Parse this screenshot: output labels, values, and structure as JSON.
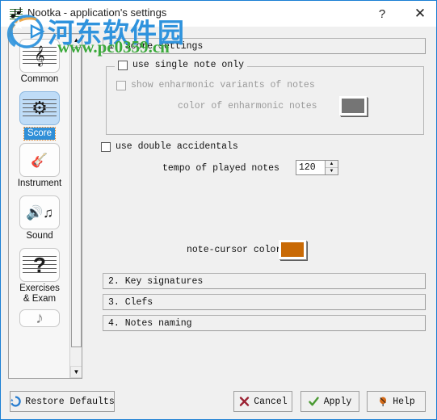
{
  "window": {
    "title": "Nootka - application's settings",
    "app_icon": "nootka-icon",
    "help_button": "?",
    "close_button": "✕",
    "border_color": "#1a7fd4"
  },
  "sidebar": {
    "scrollbar": {
      "up_arrow": "▲",
      "down_arrow": "▼"
    },
    "items": [
      {
        "label": "Common",
        "icon": "staff-clef-guitar-icon",
        "glyph": "♫",
        "selected": false
      },
      {
        "label": "Score",
        "icon": "staff-gear-icon",
        "glyph": "⚙",
        "selected": true
      },
      {
        "label": "Instrument",
        "icon": "guitar-icon",
        "glyph": "𝄞",
        "selected": false
      },
      {
        "label": "Sound",
        "icon": "speaker-note-icon",
        "glyph": "🔊",
        "selected": false
      },
      {
        "label": "Exercises\n& Exam",
        "icon": "question-mark-staff-icon",
        "glyph": "?",
        "selected": false
      },
      {
        "label": "",
        "icon": "note-partial-icon",
        "glyph": "♪",
        "selected": false
      }
    ]
  },
  "main": {
    "sections": [
      {
        "id": "sec1",
        "label": "1. Score settings",
        "expanded": true
      },
      {
        "id": "sec2",
        "label": "2. Key signatures",
        "expanded": false
      },
      {
        "id": "sec3",
        "label": "3. Clefs",
        "expanded": false
      },
      {
        "id": "sec4",
        "label": "4. Notes naming",
        "expanded": false
      }
    ],
    "score_settings": {
      "single_note_group": {
        "title": "use single note only",
        "checked": false,
        "enharmonic_checkbox": {
          "label": "show enharmonic variants of notes",
          "checked": false,
          "enabled": false
        },
        "enharmonic_color": {
          "label": "color of enharmonic notes",
          "value": "#757575",
          "enabled": false
        }
      },
      "double_accidentals": {
        "label": "use double accidentals",
        "checked": false
      },
      "tempo": {
        "label": "tempo of played notes",
        "value": "120",
        "up": "▲",
        "down": "▼"
      },
      "note_cursor_color": {
        "label": "note-cursor color",
        "value": "#c96a06"
      }
    }
  },
  "footer": {
    "buttons": [
      {
        "id": "btnRestore",
        "label": "Restore Defaults",
        "icon": "refresh-icon",
        "glyph": "↻",
        "color": "#2b7fd0"
      },
      {
        "id": "btnCancel",
        "label": "Cancel",
        "icon": "cross-icon",
        "glyph": "✖",
        "color": "#9b2233"
      },
      {
        "id": "btnApply",
        "label": "Apply",
        "icon": "check-icon",
        "glyph": "✔",
        "color": "#4a9a33"
      },
      {
        "id": "btnHelp",
        "label": "Help",
        "icon": "balloon-icon",
        "glyph": "❀",
        "color": "#d36a18"
      }
    ]
  },
  "watermark": {
    "logo": "hedong-logo",
    "chinese_text": "河东软件园",
    "url_text": "www.pc0359.cn",
    "logo_color": "#2f93dd",
    "url_color": "#3aa93a"
  }
}
